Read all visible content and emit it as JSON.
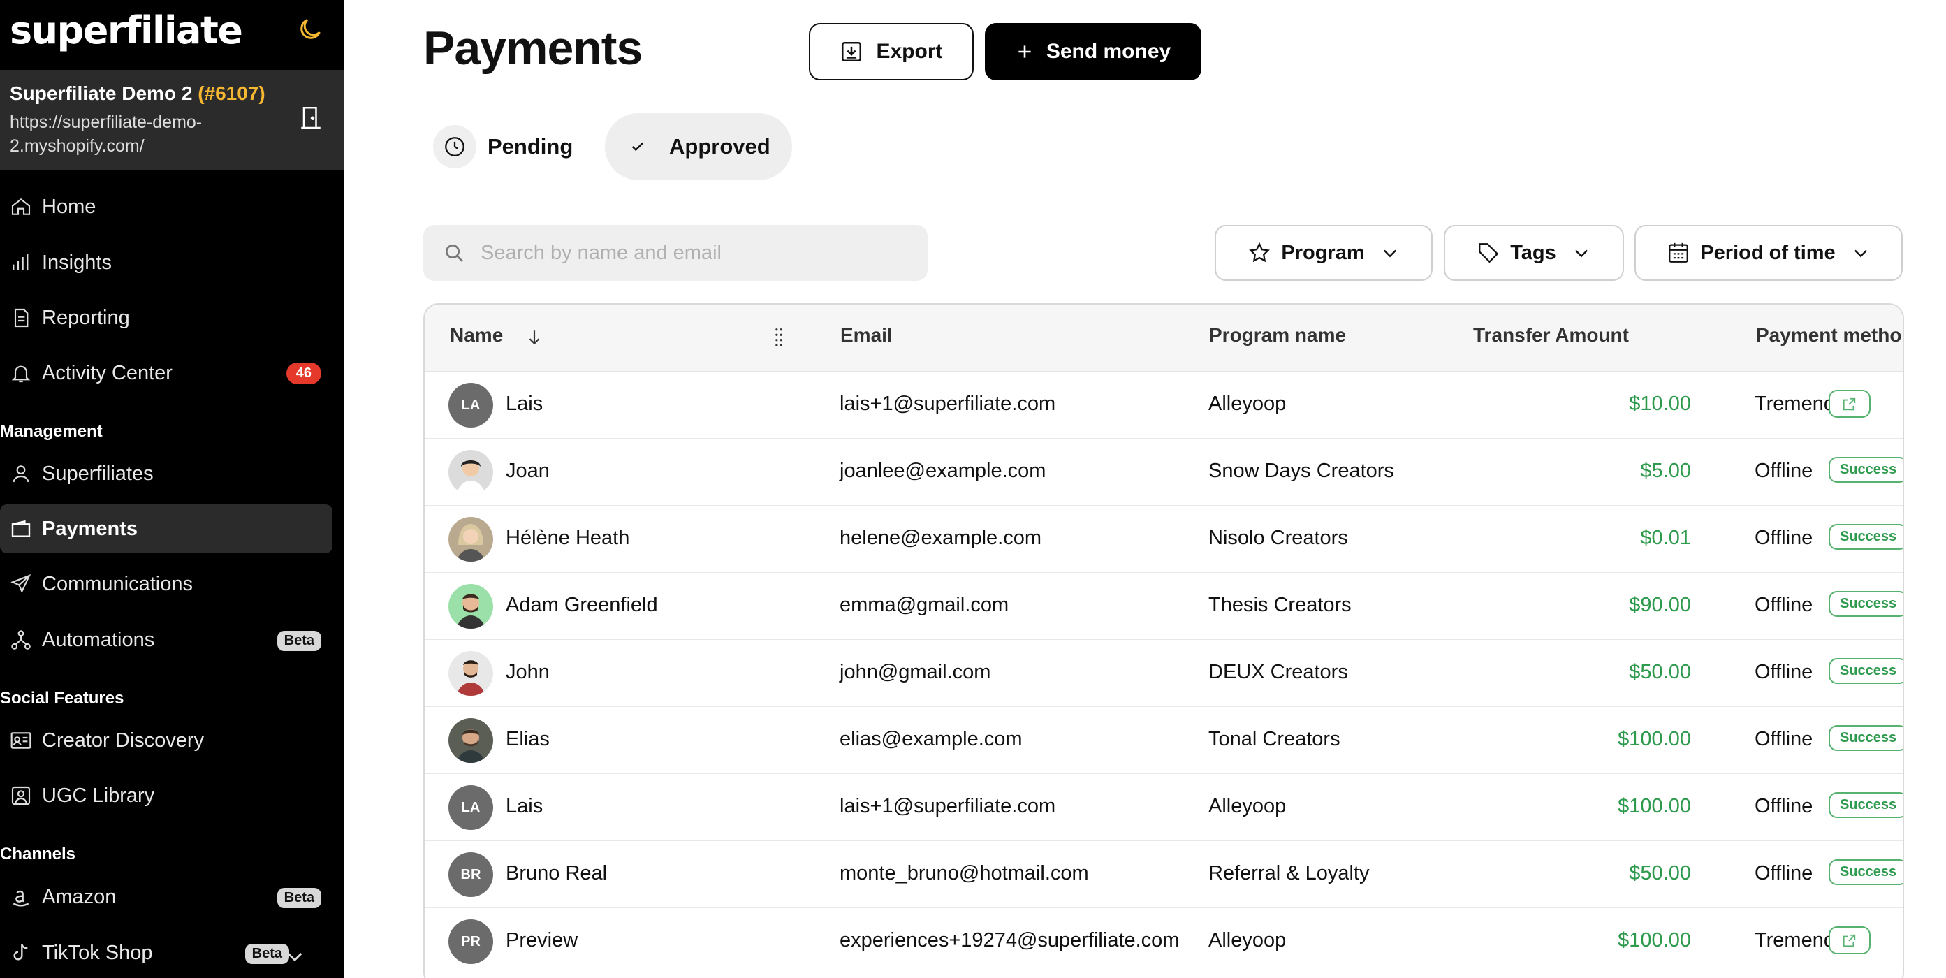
{
  "sidebar": {
    "logo": "superfiliate",
    "store": {
      "name": "Superfiliate Demo 2",
      "id": "(#6107)",
      "url": "https://superfiliate-demo-2.myshopify.com/"
    },
    "nav": {
      "home": "Home",
      "insights": "Insights",
      "reporting": "Reporting",
      "activity": "Activity Center",
      "activity_badge": "46",
      "section_management": "Management",
      "superfiliates": "Superfiliates",
      "payments": "Payments",
      "communications": "Communications",
      "automations": "Automations",
      "section_social": "Social Features",
      "creator_discovery": "Creator Discovery",
      "ugc_library": "UGC Library",
      "section_channels": "Channels",
      "amazon": "Amazon",
      "tiktok": "TikTok Shop",
      "beta": "Beta"
    }
  },
  "header": {
    "title": "Payments",
    "export": "Export",
    "send": "Send money"
  },
  "tabs": {
    "pending": "Pending",
    "approved": "Approved"
  },
  "search": {
    "placeholder": "Search by name and email"
  },
  "filters": {
    "program": "Program",
    "tags": "Tags",
    "period": "Period of time"
  },
  "table": {
    "headers": {
      "name": "Name",
      "email": "Email",
      "program": "Program name",
      "amount": "Transfer Amount",
      "method": "Payment metho"
    },
    "status_label": "Success",
    "rows": [
      {
        "initials": "LA",
        "name": "Lais",
        "email": "lais+1@superfiliate.com",
        "program": "Alleyoop",
        "amount": "$10.00",
        "method": "Tremendous"
      },
      {
        "initials": "",
        "name": "Joan",
        "email": "joanlee@example.com",
        "program": "Snow Days Creators",
        "amount": "$5.00",
        "method": "Offline"
      },
      {
        "initials": "",
        "name": "Hélène Heath",
        "email": "helene@example.com",
        "program": "Nisolo Creators",
        "amount": "$0.01",
        "method": "Offline"
      },
      {
        "initials": "",
        "name": "Adam Greenfield",
        "email": "emma@gmail.com",
        "program": "Thesis Creators",
        "amount": "$90.00",
        "method": "Offline"
      },
      {
        "initials": "",
        "name": "John",
        "email": "john@gmail.com",
        "program": "DEUX Creators",
        "amount": "$50.00",
        "method": "Offline"
      },
      {
        "initials": "",
        "name": "Elias",
        "email": "elias@example.com",
        "program": "Tonal Creators",
        "amount": "$100.00",
        "method": "Offline"
      },
      {
        "initials": "LA",
        "name": "Lais",
        "email": "lais+1@superfiliate.com",
        "program": "Alleyoop",
        "amount": "$100.00",
        "method": "Offline"
      },
      {
        "initials": "BR",
        "name": "Bruno Real",
        "email": "monte_bruno@hotmail.com",
        "program": "Referral & Loyalty",
        "amount": "$50.00",
        "method": "Offline"
      },
      {
        "initials": "PR",
        "name": "Preview",
        "email": "experiences+19274@superfiliate.com",
        "program": "Alleyoop",
        "amount": "$100.00",
        "method": "Tremendous"
      }
    ]
  },
  "colors": {
    "accent": "#f5b731",
    "success": "#2e9a4d",
    "badge": "#e5392b"
  }
}
